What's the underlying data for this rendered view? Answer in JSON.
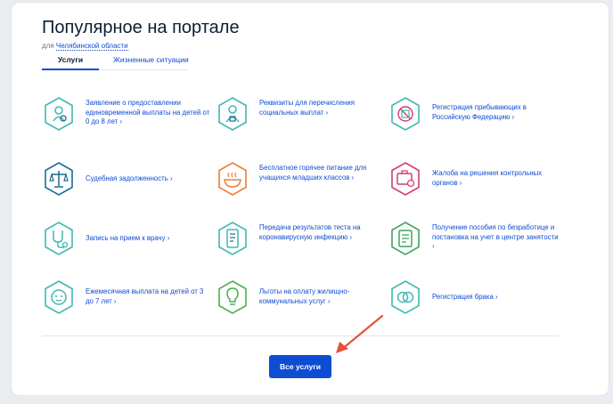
{
  "header": {
    "title": "Популярное на портале",
    "region_prefix": "для",
    "region_link": "Челябинской области"
  },
  "tabs": [
    {
      "label": "Услуги",
      "active": true
    },
    {
      "label": "Жизненные ситуации",
      "active": false
    }
  ],
  "services": [
    {
      "label": "Заявление о предоставлении единовременной выплаты на детей от 0 до 8 лет",
      "icon": "child-payment-icon",
      "color": "#3fb8b2"
    },
    {
      "label": "Реквизиты для перечисления социальных выплат",
      "icon": "social-payment-icon",
      "color": "#3fb8b2"
    },
    {
      "label": "Регистрация прибывающих в Российскую Федерацию",
      "icon": "passport-arrival-icon",
      "color": "#3fb8b2"
    },
    {
      "label": "Судебная задолженность",
      "icon": "scales-icon",
      "color": "#1a6d96"
    },
    {
      "label": "Бесплатное горячее питание для учащихся младших классов",
      "icon": "hot-meal-icon",
      "color": "#ef7d32"
    },
    {
      "label": "Жалоба на решения контрольных органов",
      "icon": "complaint-icon",
      "color": "#d33d6f"
    },
    {
      "label": "Запись на прием к врачу",
      "icon": "stethoscope-icon",
      "color": "#3fb8b2"
    },
    {
      "label": "Передача результатов теста на коронавирусную инфекцию",
      "icon": "covid-test-icon",
      "color": "#3fb8b2"
    },
    {
      "label": "Получение пособия по безработице и постановка на учет в центре занятости",
      "icon": "unemployment-icon",
      "color": "#3fa35b"
    },
    {
      "label": "Ежемесячная выплата на детей от 3 до 7 лет",
      "icon": "baby-face-icon",
      "color": "#3fb8b2"
    },
    {
      "label": "Льготы на оплату жилищно-коммунальных услуг",
      "icon": "light-bulb-icon",
      "color": "#4caf50"
    },
    {
      "label": "Регистрация брака",
      "icon": "wedding-rings-icon",
      "color": "#3fb8b2"
    }
  ],
  "all_services_button": "Все услуги",
  "colors": {
    "link": "#0d4cd3",
    "button": "#0d4cd3",
    "annotation_arrow": "#e8503a"
  }
}
